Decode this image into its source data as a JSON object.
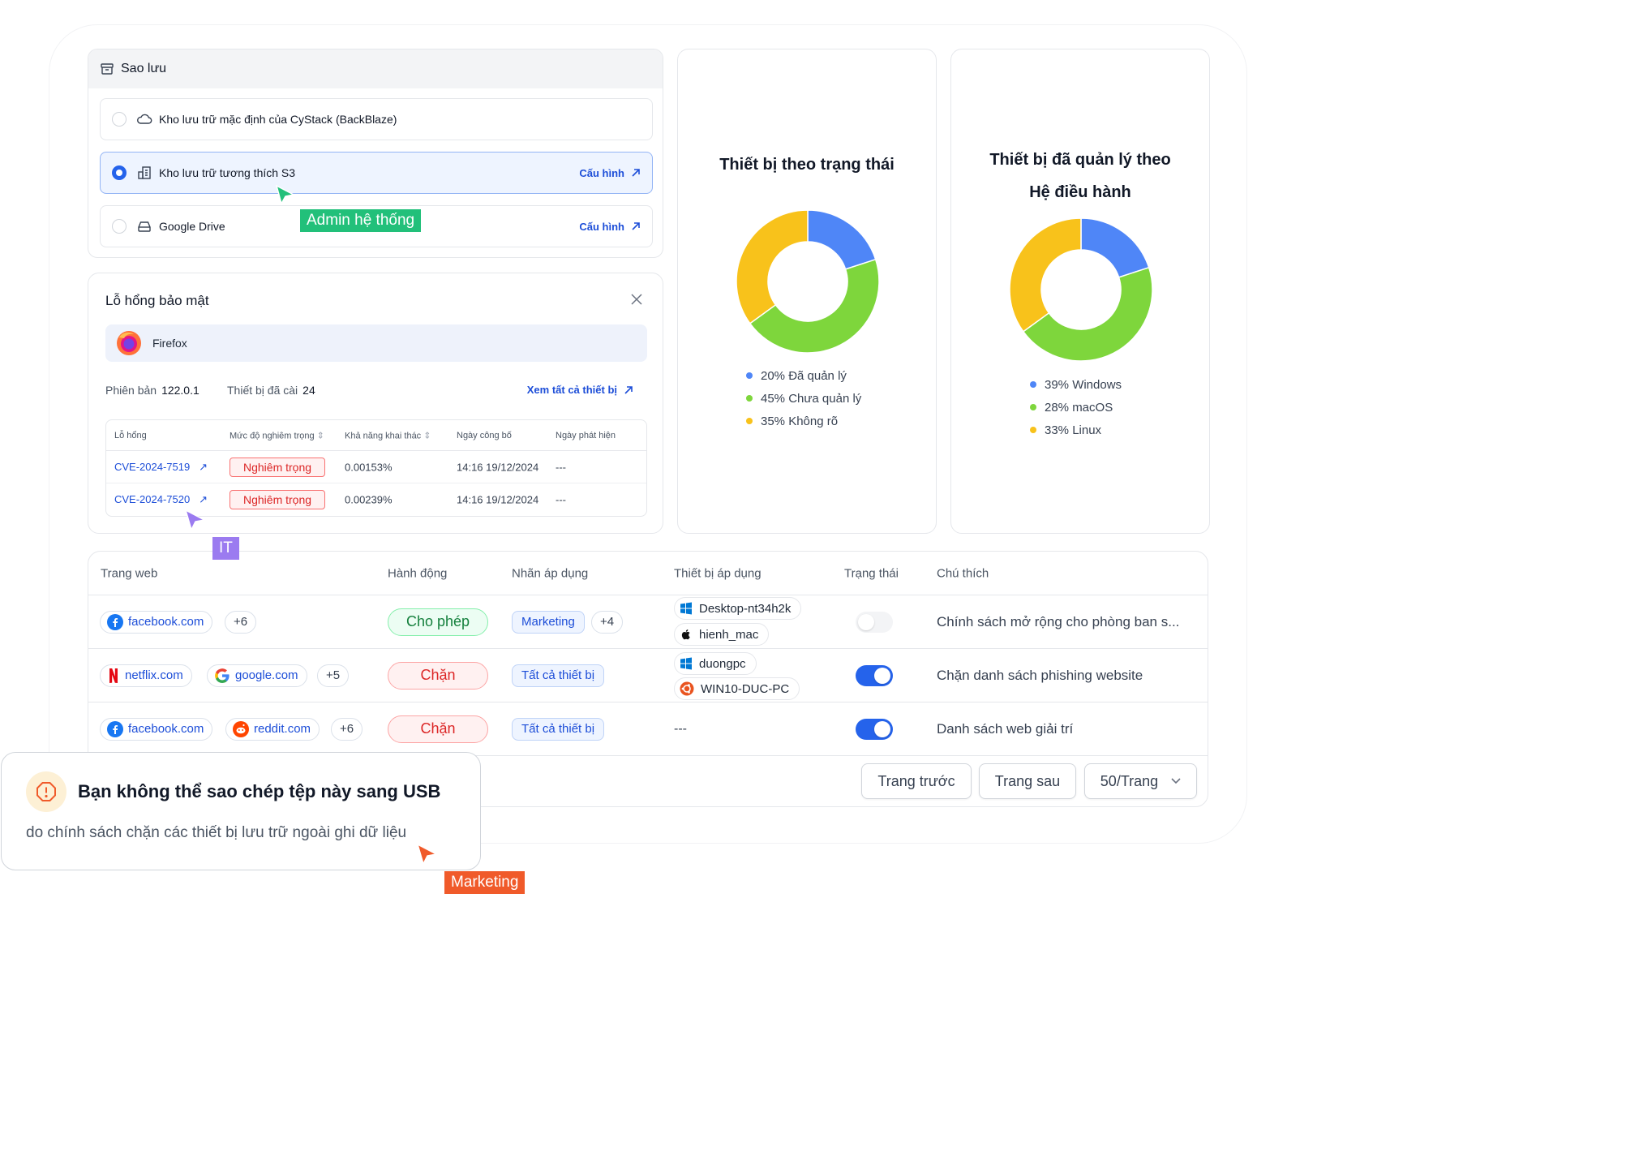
{
  "backup": {
    "title": "Sao lưu",
    "options": [
      {
        "label": "Kho lưu trữ mặc định của CyStack (BackBlaze)",
        "selected": false,
        "icon": "cloud-icon"
      },
      {
        "label": "Kho lưu trữ tương thích S3",
        "selected": true,
        "icon": "building-icon",
        "config": "Cấu hình"
      },
      {
        "label": "Google Drive",
        "selected": false,
        "icon": "drive-icon",
        "config": "Cấu hình"
      }
    ]
  },
  "vuln": {
    "title": "Lỗ hổng bảo mật",
    "app": "Firefox",
    "version_label": "Phiên bản",
    "version": "122.0.1",
    "devices_label": "Thiết bị đã cài",
    "devices": "24",
    "see_all": "Xem tất cả thiết bị",
    "columns": [
      "Lỗ hổng",
      "Mức độ nghiêm trọng",
      "Khả năng khai thác",
      "Ngày công bố",
      "Ngày phát hiện"
    ],
    "rows": [
      {
        "cve": "CVE-2024-7519",
        "severity": "Nghiêm trọng",
        "exploit": "0.00153%",
        "published": "14:16 19/12/2024",
        "detected": "---"
      },
      {
        "cve": "CVE-2024-7520",
        "severity": "Nghiêm trọng",
        "exploit": "0.00239%",
        "published": "14:16 19/12/2024",
        "detected": "---"
      }
    ]
  },
  "donut1": {
    "title": "Thiết bị theo trạng thái",
    "legend": [
      "20% Đã quản lý",
      "45% Chưa quản lý",
      "35% Không rõ"
    ]
  },
  "donut2": {
    "title_line1": "Thiết bị đã quản lý theo",
    "title_line2": "Hệ điều hành",
    "legend": [
      "39% Windows",
      "28% macOS",
      "33% Linux"
    ]
  },
  "chart_data": [
    {
      "type": "pie",
      "title": "Thiết bị theo trạng thái",
      "categories": [
        "Đã quản lý",
        "Chưa quản lý",
        "Không rõ"
      ],
      "values": [
        20,
        45,
        35
      ],
      "colors": [
        "#4f86f7",
        "#7ed63c",
        "#f8c21b"
      ],
      "donut": true,
      "legend": "bottom"
    },
    {
      "type": "pie",
      "title": "Thiết bị đã quản lý theo Hệ điều hành",
      "categories": [
        "Windows",
        "macOS",
        "Linux"
      ],
      "values": [
        20,
        45,
        35
      ],
      "legend_labels": [
        "39% Windows",
        "28% macOS",
        "33% Linux"
      ],
      "colors": [
        "#4f86f7",
        "#7ed63c",
        "#f8c21b"
      ],
      "donut": true,
      "legend": "bottom"
    }
  ],
  "web": {
    "columns": [
      "Trang web",
      "Hành động",
      "Nhãn áp dụng",
      "Thiết bị áp dụng",
      "Trạng thái",
      "Chú thích"
    ],
    "rows": [
      {
        "sites": [
          "facebook.com"
        ],
        "more": "+6",
        "action": "Cho phép",
        "label": "Marketing",
        "label_more": "+4",
        "devices": [
          "Desktop-nt34h2k",
          "hienh_mac"
        ],
        "enabled": false,
        "note": "Chính sách mở rộng cho phòng ban s..."
      },
      {
        "sites": [
          "netflix.com",
          "google.com"
        ],
        "more": "+5",
        "action": "Chặn",
        "label": "Tất cả thiết bị",
        "devices": [
          "duongpc",
          "WIN10-DUC-PC"
        ],
        "enabled": true,
        "note": "Chặn danh sách phishing website"
      },
      {
        "sites": [
          "facebook.com",
          "reddit.com"
        ],
        "more": "+6",
        "action": "Chặn",
        "label": "Tất cả thiết bị",
        "devices_text": "---",
        "enabled": true,
        "note": "Danh sách web giải trí"
      }
    ],
    "prev": "Trang trước",
    "next": "Trang sau",
    "page_size": "50/Trang"
  },
  "alert": {
    "title": "Bạn không thể sao chép tệp này sang USB",
    "message": "do chính sách chặn các thiết bị lưu trữ ngoài ghi dữ liệu"
  },
  "cursors": {
    "admin": "Admin hệ thống",
    "it": "IT",
    "marketing": "Marketing"
  },
  "colors": {
    "blue": "#4f86f7",
    "green": "#7ed63c",
    "yellow": "#f8c21b",
    "admin_label": "#22c07a",
    "it_label": "#9b7bf0",
    "marketing_label": "#f05a2a"
  }
}
